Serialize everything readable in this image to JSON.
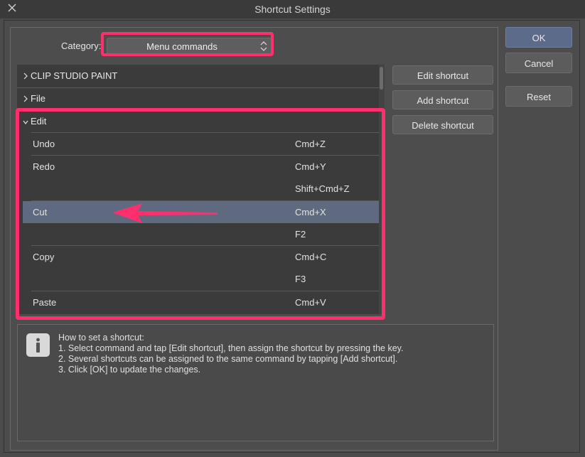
{
  "window": {
    "title": "Shortcut Settings"
  },
  "category": {
    "label": "Category:",
    "value": "Menu commands"
  },
  "tree": {
    "groups": [
      "CLIP STUDIO PAINT",
      "File",
      "Edit"
    ],
    "rows": [
      {
        "command": "Undo",
        "shortcut": "Cmd+Z"
      },
      {
        "command": "Redo",
        "shortcut": "Cmd+Y"
      },
      {
        "command": "",
        "shortcut": "Shift+Cmd+Z"
      },
      {
        "command": "Cut",
        "shortcut": "Cmd+X"
      },
      {
        "command": "",
        "shortcut": "F2"
      },
      {
        "command": "Copy",
        "shortcut": "Cmd+C"
      },
      {
        "command": "",
        "shortcut": "F3"
      },
      {
        "command": "Paste",
        "shortcut": "Cmd+V"
      }
    ]
  },
  "buttons": {
    "edit": "Edit shortcut",
    "add": "Add shortcut",
    "delete": "Delete shortcut",
    "ok": "OK",
    "cancel": "Cancel",
    "reset": "Reset"
  },
  "info": {
    "lines": [
      "How to set a shortcut:",
      "1. Select command and tap [Edit shortcut], then assign the shortcut by pressing the key.",
      "2. Several shortcuts can be assigned to the same command by tapping [Add shortcut].",
      "3. Click [OK] to update the changes."
    ]
  },
  "colors": {
    "highlight": "#ff2f6e",
    "selection": "#5f6a80",
    "ok_button": "#5d6b8a"
  },
  "icons": {
    "close": "close-icon",
    "info": "info-icon",
    "select_arrows": "up-down-arrows-icon",
    "chevron": "chevron-icon"
  }
}
